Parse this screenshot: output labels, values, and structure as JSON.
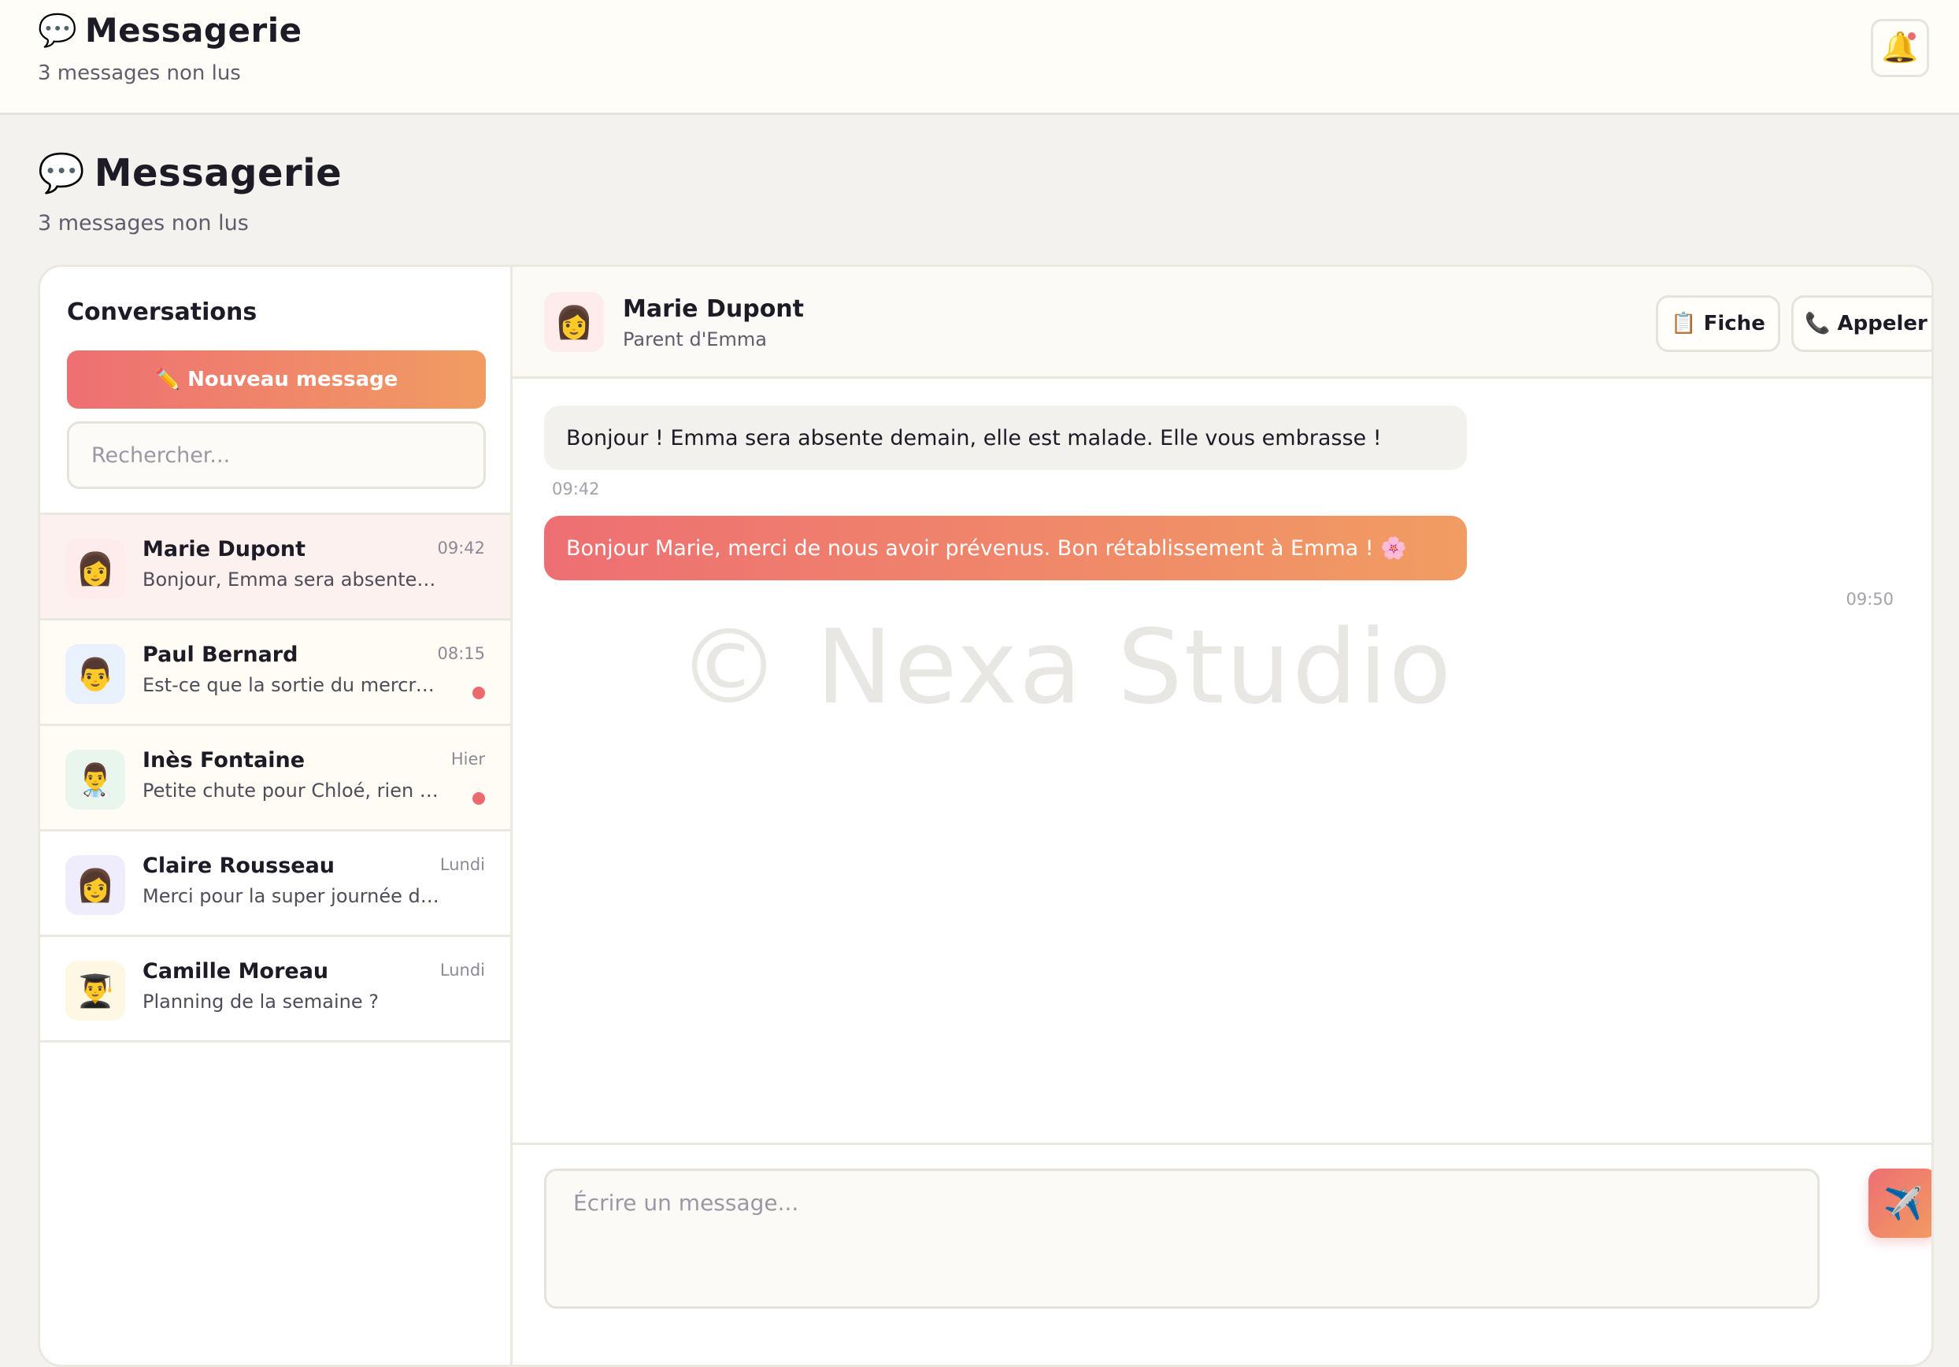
{
  "topbar": {
    "icon": "💬",
    "title": "Messagerie",
    "subtitle": "3 messages non lus",
    "bell_icon": "🔔"
  },
  "page": {
    "icon": "💬",
    "title": "Messagerie",
    "subtitle": "3 messages non lus"
  },
  "sidebar": {
    "title": "Conversations",
    "new_message": "✏️ Nouveau message",
    "search_placeholder": "Rechercher...",
    "conversations": [
      {
        "avatar": "👩",
        "name": "Marie Dupont",
        "preview": "Bonjour, Emma sera absente d...",
        "time": "09:42",
        "unread": false,
        "active": true,
        "avatar_bg": "#fdeceb"
      },
      {
        "avatar": "👨",
        "name": "Paul Bernard",
        "preview": "Est-ce que la sortie du mercre...",
        "time": "08:15",
        "unread": true,
        "active": false,
        "avatar_bg": "#e9f1fd"
      },
      {
        "avatar": "👨‍⚕️",
        "name": "Inès Fontaine",
        "preview": "Petite chute pour Chloé, rien de ...",
        "time": "Hier",
        "unread": true,
        "active": false,
        "avatar_bg": "#e8f6ee"
      },
      {
        "avatar": "👩",
        "name": "Claire Rousseau",
        "preview": "Merci pour la super journée d'h...",
        "time": "Lundi",
        "unread": false,
        "active": false,
        "avatar_bg": "#efedfb"
      },
      {
        "avatar": "👨‍🎓",
        "name": "Camille Moreau",
        "preview": "Planning de la semaine ?",
        "time": "Lundi",
        "unread": false,
        "active": false,
        "avatar_bg": "#fdf7e3"
      }
    ]
  },
  "chat": {
    "avatar": "👩",
    "name": "Marie Dupont",
    "role": "Parent d'Emma",
    "fiche_label": "📋 Fiche",
    "call_label": "📞 Appeler",
    "messages": [
      {
        "direction": "in",
        "text": "Bonjour ! Emma sera absente demain, elle est malade. Elle vous embrasse !",
        "time": "09:42"
      },
      {
        "direction": "out",
        "text": "Bonjour Marie, merci de nous avoir prévenus. Bon rétablissement à Emma ! 🌸",
        "time": "09:50"
      }
    ],
    "watermark": "© Nexa Studio",
    "input_placeholder": "Écrire un message...",
    "send_icon": "✈️"
  },
  "colors": {
    "accent_start": "#ee6f73",
    "accent_end": "#f19c62",
    "unread_dot": "#ec6a6f"
  }
}
